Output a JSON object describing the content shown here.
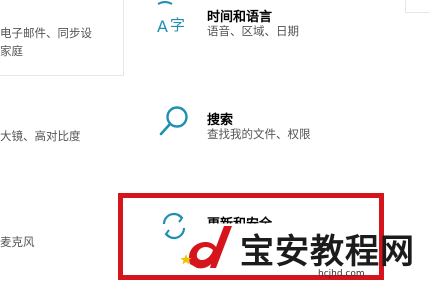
{
  "left_column": {
    "account_desc_line1": "电子邮件、同步设",
    "account_desc_line2": "家庭",
    "ease_desc": "大镜、高对比度",
    "cortana_desc": "麦克风"
  },
  "time_language": {
    "title": "时间和语言",
    "desc": "语音、区域、日期",
    "icon": "time-language-icon"
  },
  "search": {
    "title": "搜索",
    "desc": "查找我的文件、权限",
    "icon": "search-icon"
  },
  "update_security": {
    "title": "更新和安全",
    "desc": "",
    "icon": "sync-icon"
  },
  "highlight_color": "#d6141b",
  "accent_color": "#1e8fb2",
  "watermark": {
    "text": "宝安教程网",
    "url": "hcjhd.com",
    "logo": "d-logo-icon"
  }
}
